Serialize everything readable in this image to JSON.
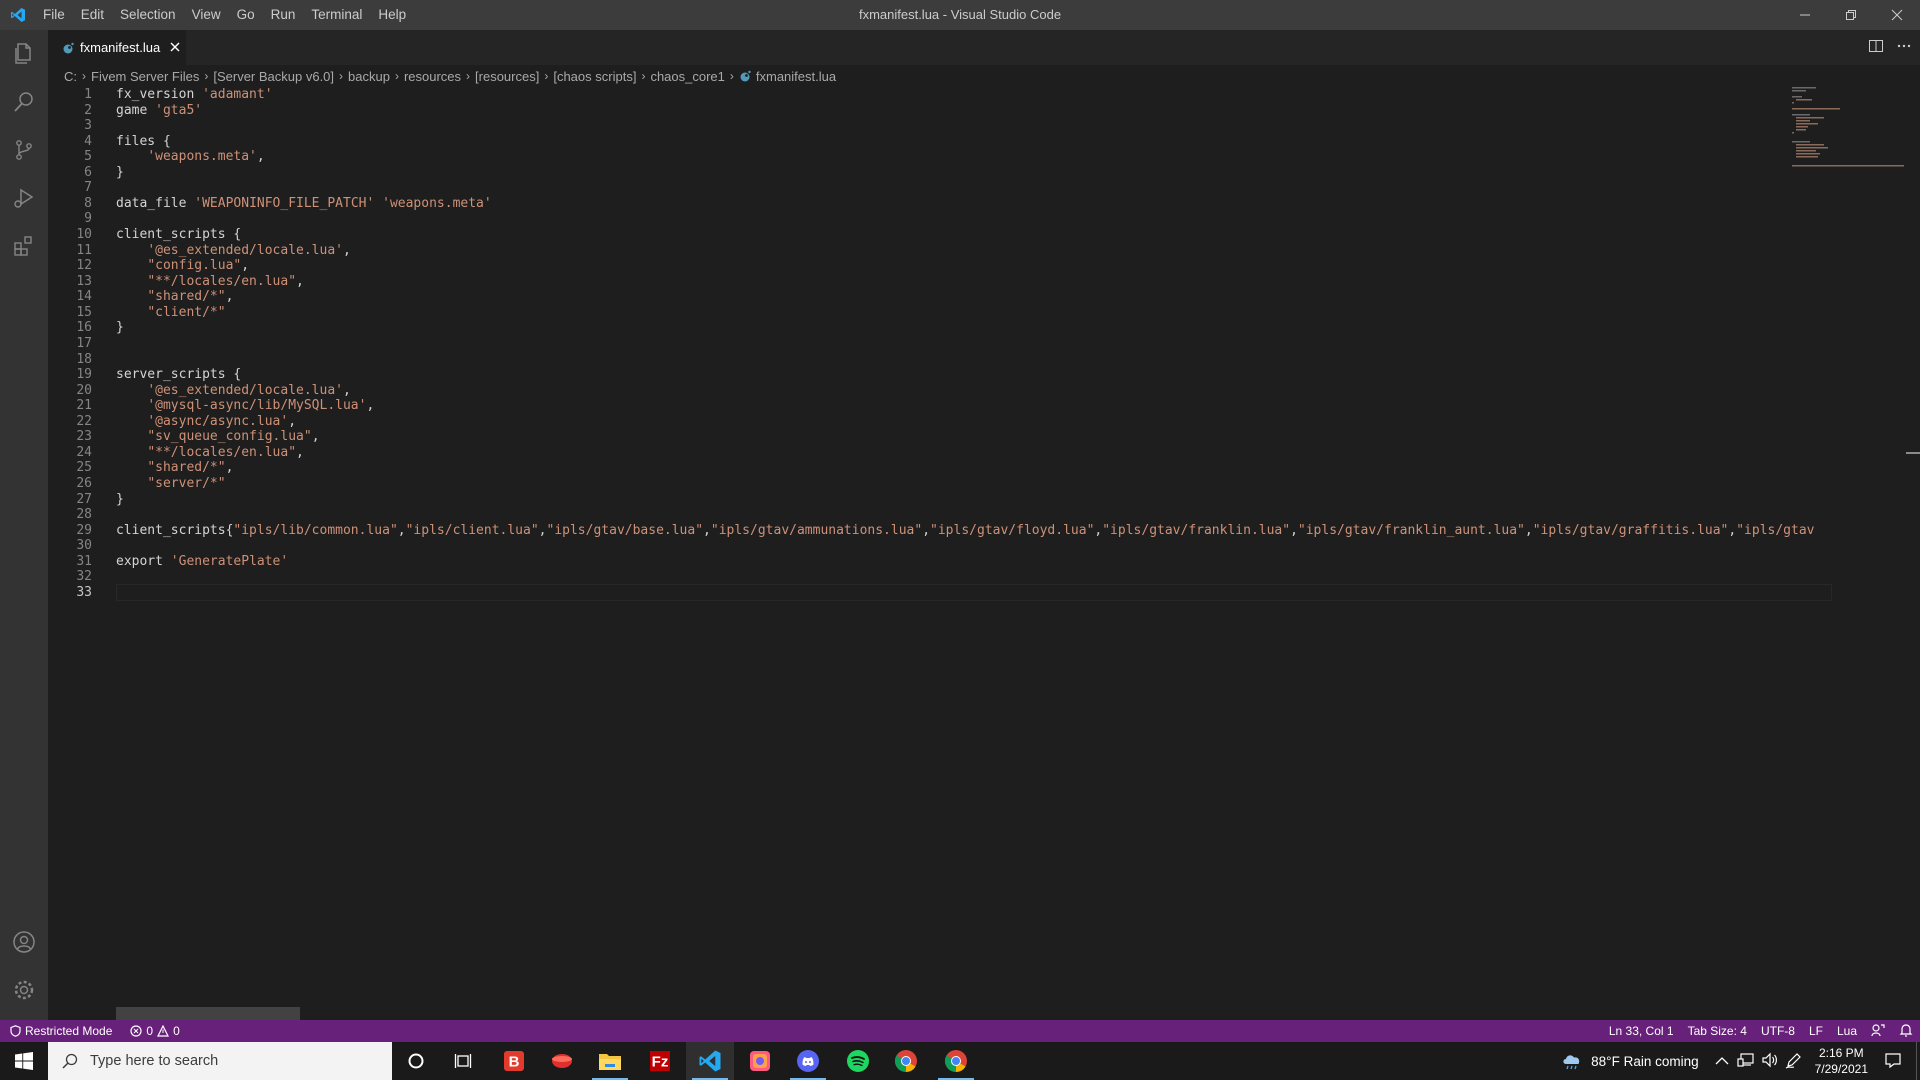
{
  "window": {
    "title": "fxmanifest.lua - Visual Studio Code",
    "menu": [
      "File",
      "Edit",
      "Selection",
      "View",
      "Go",
      "Run",
      "Terminal",
      "Help"
    ]
  },
  "tab": {
    "label": "fxmanifest.lua"
  },
  "breadcrumb": [
    "C:",
    "Fivem Server Files",
    "[Server Backup v6.0]",
    "backup",
    "resources",
    "[resources]",
    "[chaos scripts]",
    "chaos_core1",
    "fxmanifest.lua"
  ],
  "editor": {
    "line_numbers": [
      "1",
      "2",
      "3",
      "4",
      "5",
      "6",
      "7",
      "8",
      "9",
      "10",
      "11",
      "12",
      "13",
      "14",
      "15",
      "16",
      "17",
      "18",
      "19",
      "20",
      "21",
      "22",
      "23",
      "24",
      "25",
      "26",
      "27",
      "28",
      "29",
      "30",
      "31",
      "32",
      "33"
    ],
    "active_line": 33,
    "lines": [
      [
        {
          "t": "fx_version "
        },
        {
          "s": "'adamant'"
        }
      ],
      [
        {
          "t": "game "
        },
        {
          "s": "'gta5'"
        }
      ],
      [],
      [
        {
          "t": "files {"
        }
      ],
      [
        {
          "t": "    "
        },
        {
          "s": "'weapons.meta'"
        },
        {
          "t": ","
        }
      ],
      [
        {
          "t": "}"
        }
      ],
      [],
      [
        {
          "t": "data_file "
        },
        {
          "s": "'WEAPONINFO_FILE_PATCH'"
        },
        {
          "t": " "
        },
        {
          "s": "'weapons.meta'"
        }
      ],
      [],
      [
        {
          "t": "client_scripts {"
        }
      ],
      [
        {
          "t": "    "
        },
        {
          "s": "'@es_extended/locale.lua'"
        },
        {
          "t": ","
        }
      ],
      [
        {
          "t": "    "
        },
        {
          "s": "\"config.lua\""
        },
        {
          "t": ","
        }
      ],
      [
        {
          "t": "    "
        },
        {
          "s": "\"**/locales/en.lua\""
        },
        {
          "t": ","
        }
      ],
      [
        {
          "t": "    "
        },
        {
          "s": "\"shared/*\""
        },
        {
          "t": ","
        }
      ],
      [
        {
          "t": "    "
        },
        {
          "s": "\"client/*\""
        }
      ],
      [
        {
          "t": "}"
        }
      ],
      [],
      [],
      [
        {
          "t": "server_scripts {"
        }
      ],
      [
        {
          "t": "    "
        },
        {
          "s": "'@es_extended/locale.lua'"
        },
        {
          "t": ","
        }
      ],
      [
        {
          "t": "    "
        },
        {
          "s": "'@mysql-async/lib/MySQL.lua'"
        },
        {
          "t": ","
        }
      ],
      [
        {
          "t": "    "
        },
        {
          "s": "'@async/async.lua'"
        },
        {
          "t": ","
        }
      ],
      [
        {
          "t": "    "
        },
        {
          "s": "\"sv_queue_config.lua\""
        },
        {
          "t": ","
        }
      ],
      [
        {
          "t": "    "
        },
        {
          "s": "\"**/locales/en.lua\""
        },
        {
          "t": ","
        }
      ],
      [
        {
          "t": "    "
        },
        {
          "s": "\"shared/*\""
        },
        {
          "t": ","
        }
      ],
      [
        {
          "t": "    "
        },
        {
          "s": "\"server/*\""
        }
      ],
      [
        {
          "t": "}"
        }
      ],
      [],
      [
        {
          "t": "client_scripts{"
        },
        {
          "s": "\"ipls/lib/common.lua\""
        },
        {
          "t": ","
        },
        {
          "s": "\"ipls/client.lua\""
        },
        {
          "t": ","
        },
        {
          "s": "\"ipls/gtav/base.lua\""
        },
        {
          "t": ","
        },
        {
          "s": "\"ipls/gtav/ammunations.lua\""
        },
        {
          "t": ","
        },
        {
          "s": "\"ipls/gtav/floyd.lua\""
        },
        {
          "t": ","
        },
        {
          "s": "\"ipls/gtav/franklin.lua\""
        },
        {
          "t": ","
        },
        {
          "s": "\"ipls/gtav/franklin_aunt.lua\""
        },
        {
          "t": ","
        },
        {
          "s": "\"ipls/gtav/graffitis.lua\""
        },
        {
          "t": ","
        },
        {
          "s": "\"ipls/gtav"
        }
      ],
      [],
      [
        {
          "t": "export "
        },
        {
          "s": "'GeneratePlate'"
        }
      ],
      [],
      []
    ]
  },
  "statusbar": {
    "restricted": "Restricted Mode",
    "errors": "0",
    "warnings": "0",
    "position": "Ln 33, Col 1",
    "tab_size": "Tab Size: 4",
    "encoding": "UTF-8",
    "eol": "LF",
    "language": "Lua"
  },
  "taskbar": {
    "search_placeholder": "Type here to search",
    "weather": "88°F  Rain coming",
    "time": "2:16 PM",
    "date": "7/29/2021"
  },
  "colors": {
    "statusbar": "#68217a",
    "string": "#ce9178",
    "text": "#d4d4d4",
    "line_number": "#858585"
  }
}
